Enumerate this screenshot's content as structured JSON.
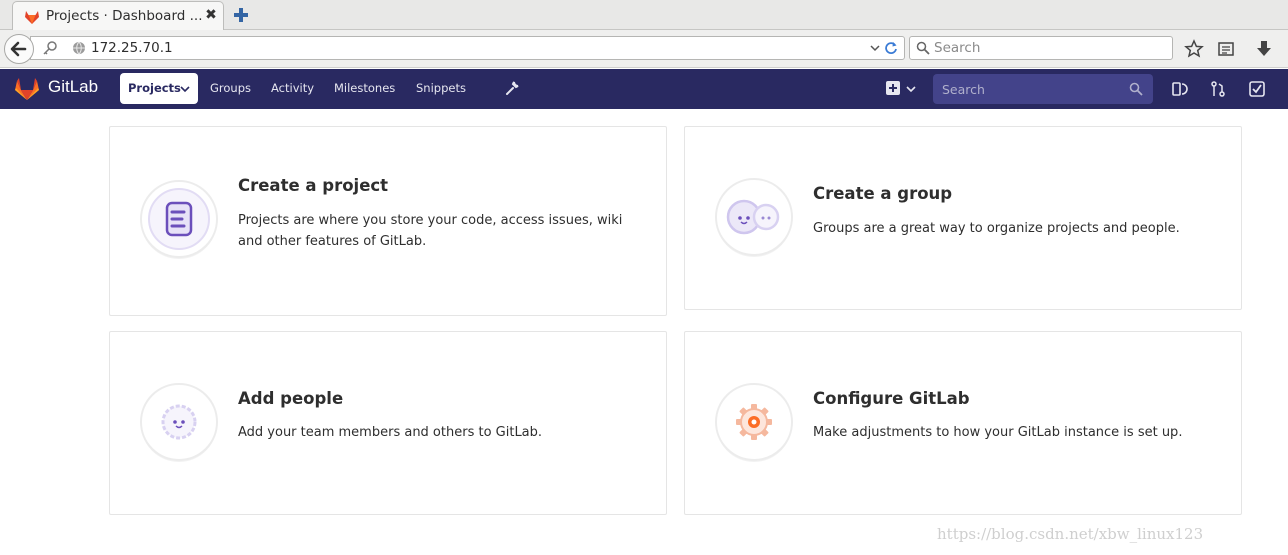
{
  "browser": {
    "tab_title": "Projects · Dashboard ...",
    "tab_close": "✖",
    "url": "172.25.70.1",
    "search_placeholder": "Search"
  },
  "gitlab": {
    "brand": "GitLab",
    "nav": {
      "projects": "Projects",
      "groups": "Groups",
      "activity": "Activity",
      "milestones": "Milestones",
      "snippets": "Snippets"
    },
    "search_placeholder": "Search"
  },
  "cards": {
    "create_project": {
      "title": "Create a project",
      "description": "Projects are where you store your code, access issues, wiki and other features of GitLab."
    },
    "create_group": {
      "title": "Create a group",
      "description": "Groups are a great way to organize projects and people."
    },
    "add_people": {
      "title": "Add people",
      "description": "Add your team members and others to GitLab."
    },
    "configure_gitlab": {
      "title": "Configure GitLab",
      "description": "Make adjustments to how your GitLab instance is set up."
    }
  },
  "watermark": "https://blog.csdn.net/xbw_linux123",
  "colors": {
    "gitlab_header": "#292961",
    "gitlab_orange": "#e24329",
    "illustration_purple": "#6b4fbb"
  }
}
